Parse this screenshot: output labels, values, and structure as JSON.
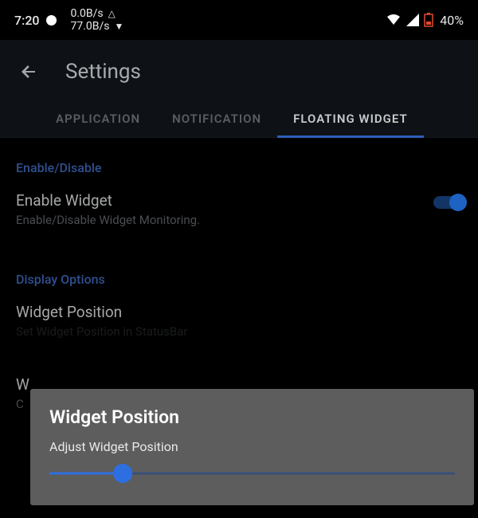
{
  "status": {
    "clock": "7:20",
    "speed_up": "0.0B/s",
    "speed_down": "77.0B/s",
    "battery_pct": "40%"
  },
  "appbar": {
    "title": "Settings"
  },
  "tabs": {
    "application": "APPLICATION",
    "notification": "NOTIFICATION",
    "floating": "FLOATING WIDGET"
  },
  "sections": {
    "enable_disable": "Enable/Disable",
    "display_options": "Display Options"
  },
  "settings": {
    "enable_widget": {
      "title": "Enable Widget",
      "subtitle": "Enable/Disable Widget Monitoring."
    },
    "widget_position": {
      "title": "Widget Position",
      "subtitle": "Set Widget Position in StatusBar"
    },
    "hidden_row": {
      "title": "W",
      "subtitle": "C"
    }
  },
  "dialog": {
    "title": "Widget Position",
    "subtitle": "Adjust Widget Position",
    "value_pct": 18
  },
  "colors": {
    "accent": "#2d6fe0",
    "section": "#2f4f8f"
  }
}
